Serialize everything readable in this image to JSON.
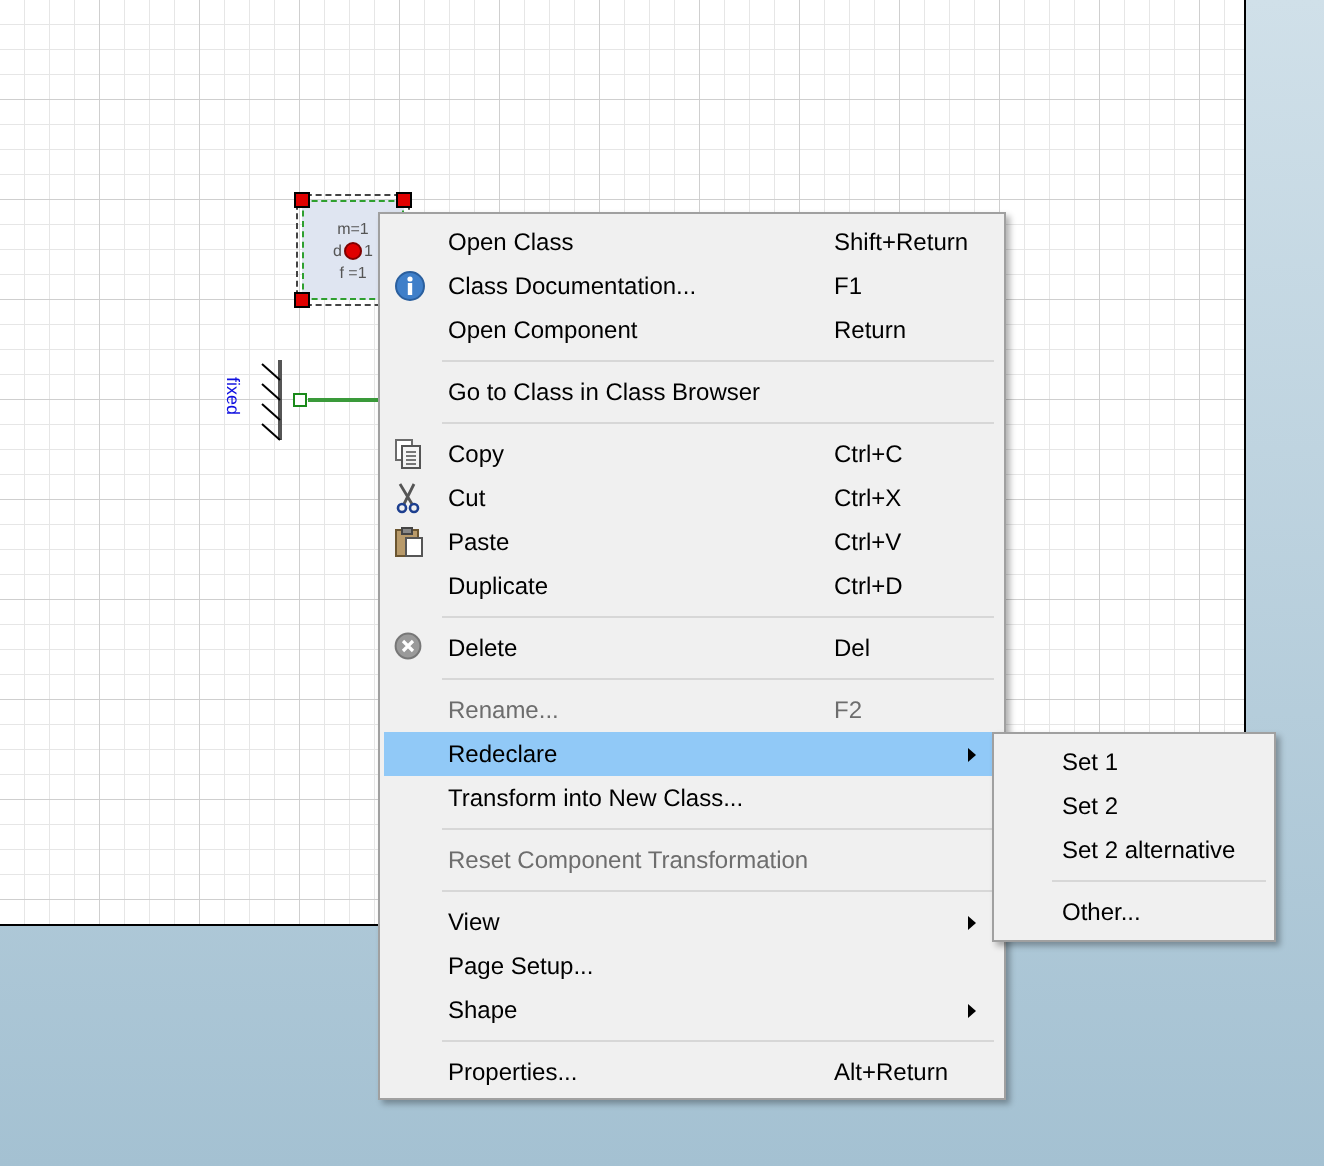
{
  "diagram": {
    "component": {
      "params": [
        "m=1",
        "d",
        "1",
        "f =1"
      ],
      "selected": true
    },
    "fixed": {
      "label": "fixed"
    }
  },
  "context_menu": {
    "items": [
      {
        "kind": "item",
        "label": "Open Class",
        "shortcut": "Shift+Return",
        "disabled": false,
        "selected": false
      },
      {
        "kind": "item",
        "label": "Class Documentation...",
        "shortcut": "F1",
        "disabled": false,
        "selected": false
      },
      {
        "kind": "item",
        "label": "Open Component",
        "shortcut": "Return",
        "disabled": false,
        "selected": false
      },
      {
        "kind": "separator"
      },
      {
        "kind": "item",
        "label": "Go to Class in Class Browser",
        "disabled": false,
        "selected": false
      },
      {
        "kind": "separator"
      },
      {
        "kind": "item",
        "label": "Copy",
        "shortcut": "Ctrl+C",
        "disabled": false,
        "selected": false
      },
      {
        "kind": "item",
        "label": "Cut",
        "shortcut": "Ctrl+X",
        "disabled": false,
        "selected": false
      },
      {
        "kind": "item",
        "label": "Paste",
        "shortcut": "Ctrl+V",
        "disabled": false,
        "selected": false
      },
      {
        "kind": "item",
        "label": "Duplicate",
        "shortcut": "Ctrl+D",
        "disabled": false,
        "selected": false
      },
      {
        "kind": "separator"
      },
      {
        "kind": "item",
        "label": "Delete",
        "shortcut": "Del",
        "disabled": false,
        "selected": false
      },
      {
        "kind": "separator"
      },
      {
        "kind": "item",
        "label": "Rename...",
        "shortcut": "F2",
        "disabled": true,
        "selected": false
      },
      {
        "kind": "submenu",
        "label": "Redeclare",
        "disabled": false,
        "selected": true
      },
      {
        "kind": "item",
        "label": "Transform into New Class...",
        "disabled": false,
        "selected": false
      },
      {
        "kind": "separator"
      },
      {
        "kind": "item",
        "label": "Reset Component Transformation",
        "disabled": true,
        "selected": false
      },
      {
        "kind": "separator"
      },
      {
        "kind": "submenu",
        "label": "View",
        "disabled": false,
        "selected": false
      },
      {
        "kind": "item",
        "label": "Page Setup...",
        "disabled": false,
        "selected": false
      },
      {
        "kind": "submenu",
        "label": "Shape",
        "disabled": false,
        "selected": false
      },
      {
        "kind": "separator"
      },
      {
        "kind": "item",
        "label": "Properties...",
        "shortcut": "Alt+Return",
        "disabled": false,
        "selected": false
      }
    ]
  },
  "submenu": {
    "items": [
      {
        "kind": "item",
        "label": "Set 1",
        "selected": false
      },
      {
        "kind": "item",
        "label": "Set 2",
        "selected": false
      },
      {
        "kind": "item",
        "label": "Set 2 alternative",
        "selected": false
      },
      {
        "kind": "separator"
      },
      {
        "kind": "item",
        "label": "Other...",
        "selected": false
      }
    ]
  }
}
